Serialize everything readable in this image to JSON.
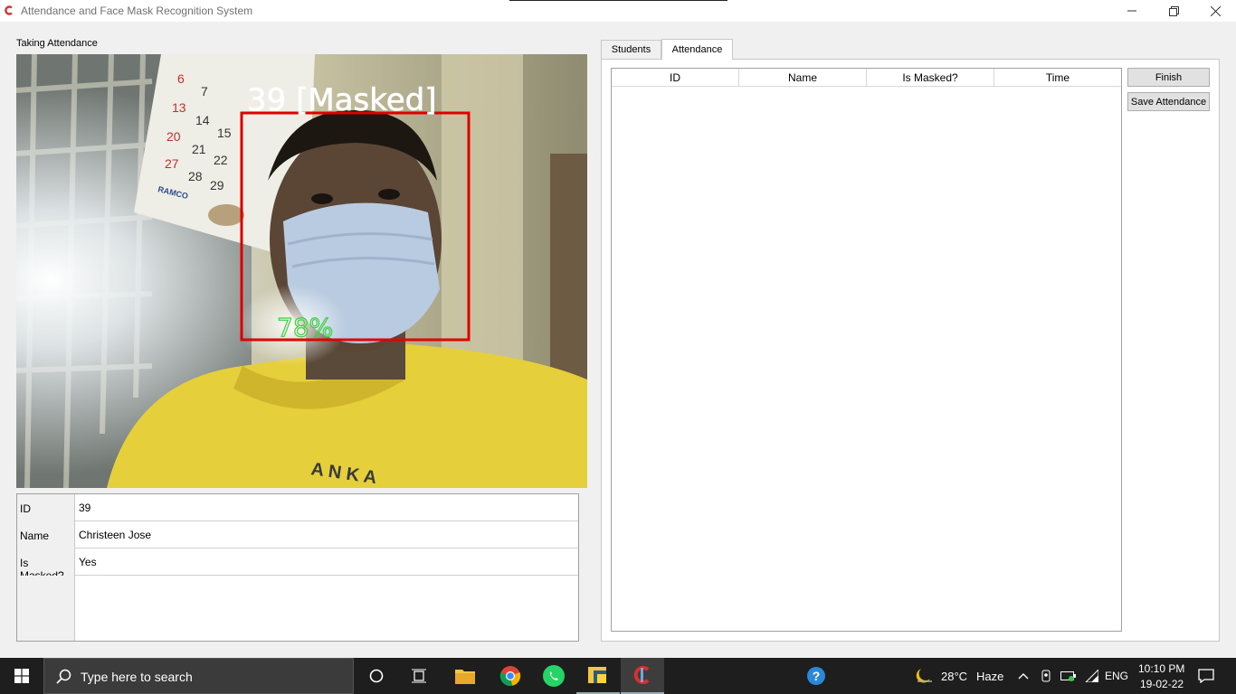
{
  "window": {
    "title": "Attendance and Face Mask Recognition System"
  },
  "capture": {
    "label": "Taking Attendance",
    "overlay_label": "39 [Masked]",
    "confidence": "78%",
    "calendar_dates": [
      "6",
      "7",
      "13",
      "14",
      "15",
      "20",
      "21",
      "22",
      "27",
      "28",
      "29"
    ],
    "calendar_brand": "RAMCO",
    "shirt_text": "A N K A"
  },
  "info": {
    "rows": [
      {
        "key": "ID",
        "value": "39"
      },
      {
        "key": "Name",
        "value": "Christeen Jose"
      },
      {
        "key": "Is Masked?",
        "value": "Yes"
      }
    ]
  },
  "tabs": {
    "students": "Students",
    "attendance": "Attendance"
  },
  "attendance_table": {
    "columns": [
      "ID",
      "Name",
      "Is Masked?",
      "Time"
    ],
    "rows": []
  },
  "buttons": {
    "finish": "Finish",
    "save": "Save Attendance"
  },
  "taskbar": {
    "search_placeholder": "Type here to search",
    "temperature": "28°C",
    "weather": "Haze",
    "language": "ENG",
    "time": "10:10 PM",
    "date": "19-02-22"
  },
  "colors": {
    "detection_box": "#e00000",
    "confidence_text": "#3fd03f",
    "shirt": "#e5cf3a",
    "taskbar": "#1e1e1e"
  }
}
